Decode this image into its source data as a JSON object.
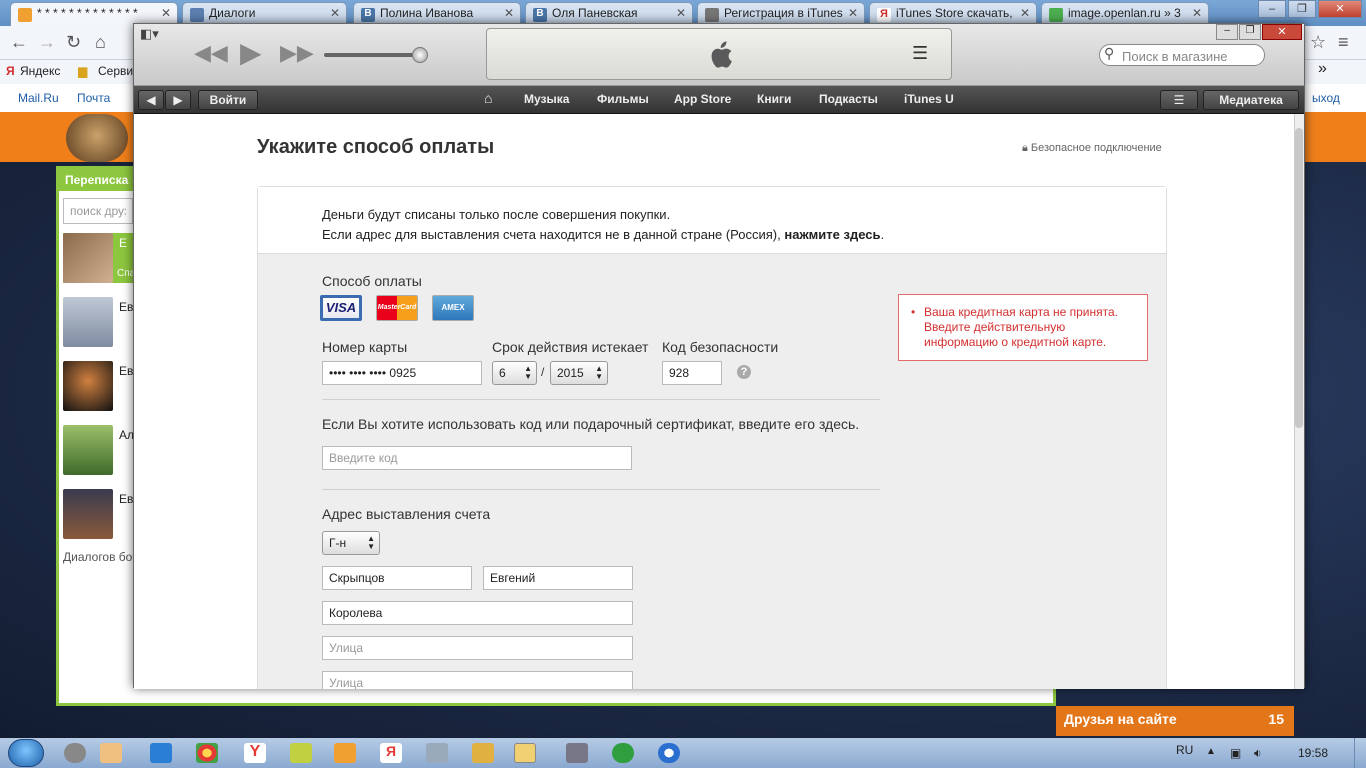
{
  "chrome": {
    "tabs": [
      {
        "label": "* * * * * * * * * * * * *",
        "color": "#f0a030"
      },
      {
        "label": "Диалоги",
        "color": "#5b7fb0"
      },
      {
        "label": "Полина Иванова",
        "color": "#4a76a8"
      },
      {
        "label": "Оля Паневская",
        "color": "#4a76a8"
      },
      {
        "label": "Регистрация в iTunes",
        "color": "#777777"
      },
      {
        "label": "iTunes Store скачать,",
        "color": "#d32f2f"
      },
      {
        "label": "image.openlan.ru » 3",
        "color": "#4caf50"
      }
    ],
    "bookmarks": [
      "Яндекс",
      "Серви"
    ]
  },
  "site": {
    "links": [
      "Mail.Ru",
      "Почта"
    ],
    "logout": "ыход",
    "messages_tab": "Переписка",
    "friend_search_placeholder": "поиск друз",
    "friends": [
      {
        "name": "Е",
        "sub": "Спа"
      },
      {
        "name": "Ев"
      },
      {
        "name": "Ев"
      },
      {
        "name": "Ал"
      },
      {
        "name": "Ев"
      }
    ],
    "dialogs_text": "Диалогов бо",
    "friends_online_label": "Друзья на сайте",
    "friends_online_count": "15"
  },
  "itunes": {
    "search_placeholder": "Поиск в магазине",
    "nav": {
      "login": "Войти",
      "items": [
        "Музыка",
        "Фильмы",
        "App Store",
        "Книги",
        "Подкасты",
        "iTunes U"
      ],
      "library": "Медиатека"
    },
    "page": {
      "title": "Укажите способ оплаты",
      "secure": "Безопасное подключение",
      "info_line1": "Деньги будут списаны только после совершения покупки.",
      "info_line2": "Если адрес для выставления счета находится не в данной стране (Россия),",
      "info_link": "нажмите здесь",
      "info_end": ".",
      "payment_method_label": "Способ оплаты",
      "cards": [
        "VISA",
        "MasterCard",
        "AMEX"
      ],
      "card_number_label": "Номер карты",
      "card_number_value": "•••• •••• •••• 0925",
      "expiry_label": "Срок действия истекает",
      "expiry_month": "6",
      "expiry_sep": "/",
      "expiry_year": "2015",
      "cvv_label": "Код безопасности",
      "cvv_value": "928",
      "help": "?",
      "error": "Ваша кредитная карта не принята. Введите действительную информацию о кредитной карте.",
      "gift_label": "Если Вы хотите использовать код или подарочный сертификат, введите его здесь.",
      "gift_placeholder": "Введите код",
      "billing_label": "Адрес выставления счета",
      "salutation": "Г-н",
      "last_name": "Скрыпцов",
      "first_name": "Евгений",
      "address1": "Королева",
      "street_placeholder_1": "Улица",
      "street_placeholder_2": "Улица"
    }
  },
  "taskbar": {
    "lang": "RU",
    "time": "19:58"
  }
}
